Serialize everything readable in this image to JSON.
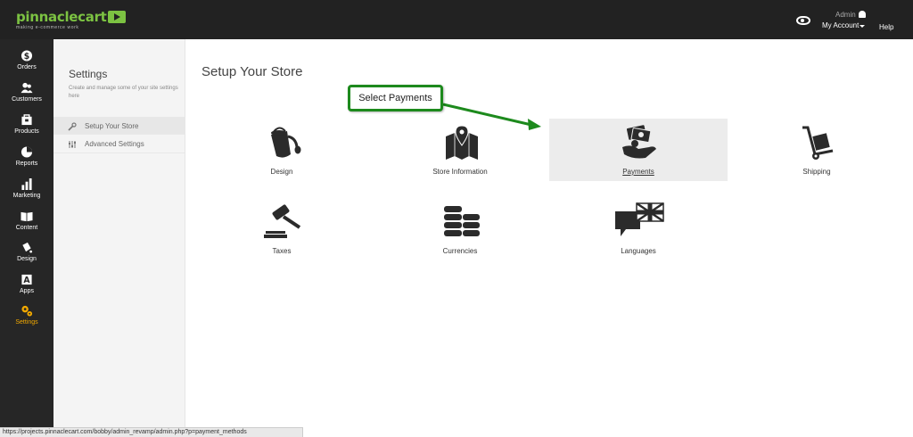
{
  "header": {
    "logo_text": "pinnaclecart",
    "logo_tagline": "making e-commerce work",
    "admin_label": "Admin",
    "account_label": "My Account",
    "help_label": "Help"
  },
  "sidebar": {
    "items": [
      {
        "label": "Orders",
        "icon": "dollar-icon"
      },
      {
        "label": "Customers",
        "icon": "users-icon"
      },
      {
        "label": "Products",
        "icon": "box-icon"
      },
      {
        "label": "Reports",
        "icon": "pie-chart-icon"
      },
      {
        "label": "Marketing",
        "icon": "bar-chart-icon"
      },
      {
        "label": "Content",
        "icon": "book-icon"
      },
      {
        "label": "Design",
        "icon": "paint-icon"
      },
      {
        "label": "Apps",
        "icon": "apps-icon"
      },
      {
        "label": "Settings",
        "icon": "gears-icon",
        "active": true
      }
    ]
  },
  "subpanel": {
    "title": "Settings",
    "description": "Create and manage some of your site settings here",
    "items": [
      {
        "label": "Setup Your Store",
        "icon": "wrench-icon",
        "active": true
      },
      {
        "label": "Advanced Settings",
        "icon": "sliders-icon"
      }
    ]
  },
  "main": {
    "title": "Setup Your Store",
    "callout": "Select Payments",
    "tiles": [
      {
        "label": "Design",
        "icon": "paint-bucket-icon"
      },
      {
        "label": "Store Information",
        "icon": "map-pin-icon"
      },
      {
        "label": "Payments",
        "icon": "money-hand-icon",
        "selected": true
      },
      {
        "label": "Shipping",
        "icon": "hand-truck-icon"
      },
      {
        "label": "Taxes",
        "icon": "gavel-icon"
      },
      {
        "label": "Currencies",
        "icon": "coin-stack-icon"
      },
      {
        "label": "Languages",
        "icon": "chat-flag-icon"
      }
    ]
  },
  "status_url": "https://projects.pinnaclecart.com/bobby/admin_revamp/admin.php?p=payment_methods",
  "colors": {
    "accent_green": "#1d8a1d",
    "brand_green": "#7cc242",
    "active_nav": "#f2a900",
    "topbar": "#222222"
  }
}
